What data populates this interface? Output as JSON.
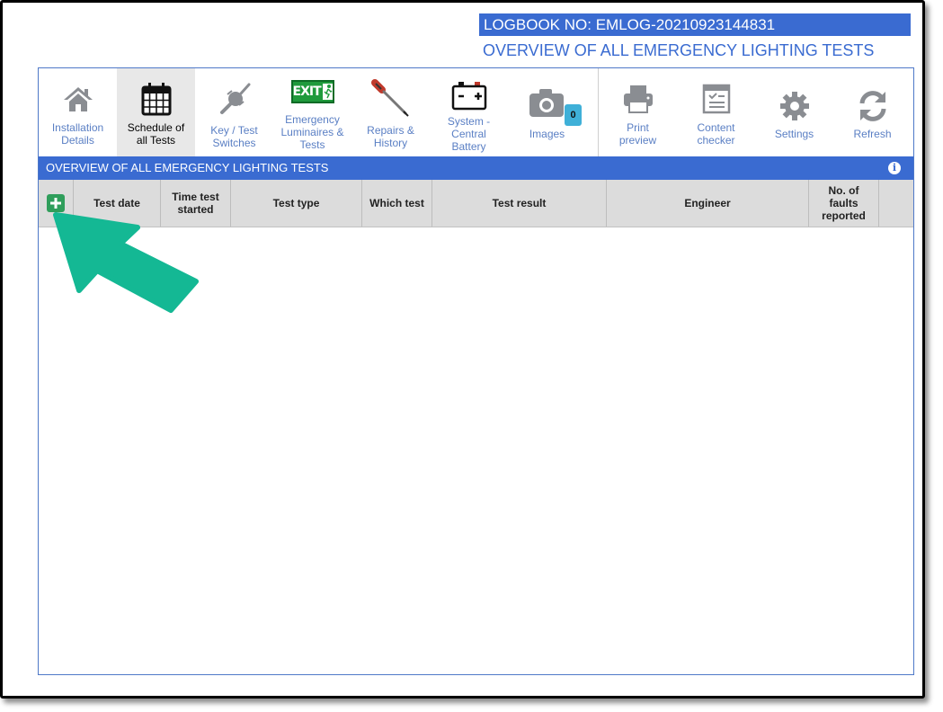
{
  "header": {
    "logbook_no": "LOGBOOK NO: EMLOG-20210923144831",
    "overview_title": "OVERVIEW OF ALL EMERGENCY LIGHTING TESTS"
  },
  "toolbar": {
    "items": [
      {
        "label_1": "Installation",
        "label_2": "Details",
        "icon": "home-icon"
      },
      {
        "label_1": "Schedule of",
        "label_2": "all Tests",
        "icon": "calendar-icon",
        "active": true
      },
      {
        "label_1": "Key / Test",
        "label_2": "Switches",
        "icon": "key-switch-icon"
      },
      {
        "label_1": "Emergency",
        "label_2": "Luminaires &",
        "label_3": "Tests",
        "icon": "exit-sign-icon",
        "exit_text": "EXIT"
      },
      {
        "label_1": "Repairs &",
        "label_2": "History",
        "icon": "screwdriver-icon"
      },
      {
        "label_1": "System -",
        "label_2": "Central",
        "label_3": "Battery",
        "icon": "battery-icon"
      },
      {
        "label_1": "Images",
        "icon": "camera-icon",
        "badge": "0"
      },
      {
        "label_1": "Print",
        "label_2": "preview",
        "icon": "printer-icon"
      },
      {
        "label_1": "Content",
        "label_2": "checker",
        "icon": "checklist-icon"
      },
      {
        "label_1": "Settings",
        "icon": "gear-icon"
      },
      {
        "label_1": "Refresh",
        "icon": "refresh-icon"
      }
    ]
  },
  "section": {
    "title": "OVERVIEW OF ALL EMERGENCY LIGHTING TESTS"
  },
  "table": {
    "columns": [
      {
        "label": ""
      },
      {
        "label": "Test date"
      },
      {
        "label_1": "Time test",
        "label_2": "started"
      },
      {
        "label": "Test type"
      },
      {
        "label": "Which test"
      },
      {
        "label": "Test result"
      },
      {
        "label": "Engineer"
      },
      {
        "label_1": "No. of",
        "label_2": "faults",
        "label_3": "reported"
      },
      {
        "label": ""
      }
    ],
    "rows": []
  },
  "colors": {
    "primary_blue": "#3a6bd1",
    "add_green": "#2f9e5b",
    "arrow_teal": "#14b894",
    "badge_blue": "#3fb0d8",
    "exit_green": "#1f9a3c"
  }
}
